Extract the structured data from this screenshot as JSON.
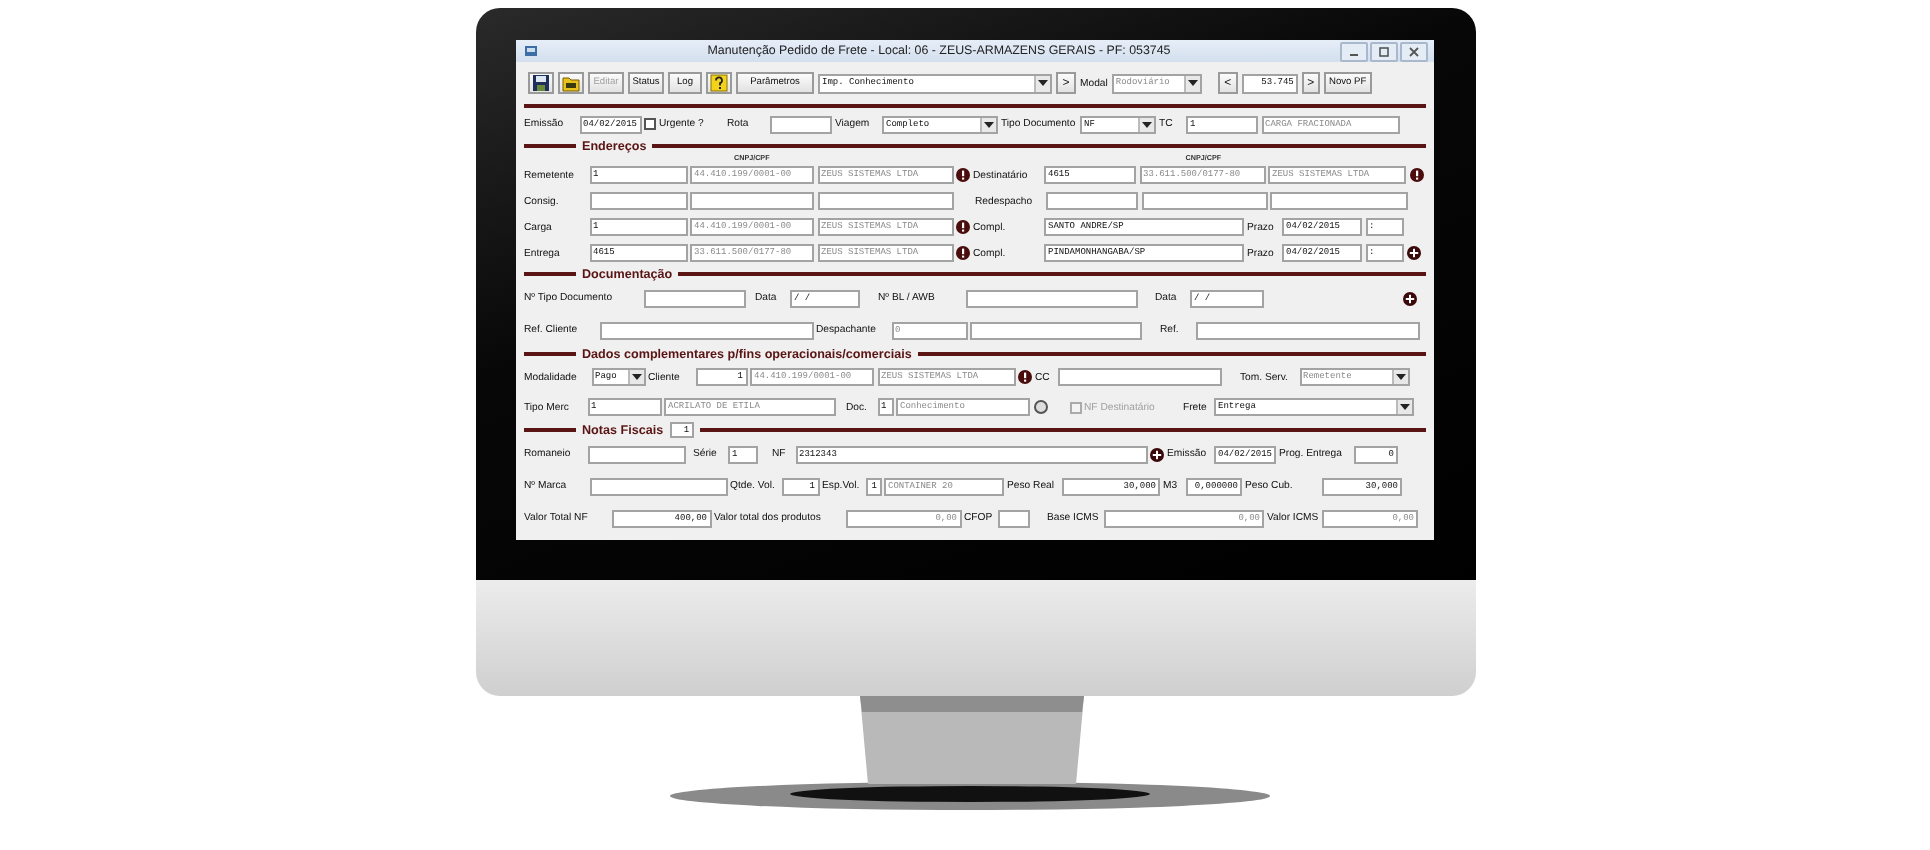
{
  "window": {
    "title": "Manutenção Pedido de Frete - Local: 06 - ZEUS-ARMAZENS GERAIS - PF: 053745"
  },
  "toolbar": {
    "buttons": [
      {
        "label": "Editar",
        "disabled": true
      },
      {
        "label": "Status",
        "disabled": false
      },
      {
        "label": "Log",
        "disabled": false
      }
    ],
    "parameters_button": "Parâmetros",
    "print_select": "Imp. Conhecimento",
    "print_next": ">",
    "modal_label": "Modal",
    "modal_select": {
      "value": "Rodoviário",
      "disabled": true
    },
    "prev": "<",
    "record_number": "53.745",
    "next": ">",
    "new_button": "Novo PF"
  },
  "top_row": [
    {
      "kind": "label",
      "text": "Emissão"
    },
    {
      "kind": "field",
      "value": "04/02/2015",
      "disabled": false
    },
    {
      "kind": "checkbox",
      "label": "Urgente ?",
      "checked": false,
      "disabled": false
    },
    {
      "kind": "label",
      "text": "Rota"
    },
    {
      "kind": "field"
    },
    {
      "kind": "label",
      "text": "Viagem"
    },
    {
      "kind": "select",
      "value": "Completo",
      "disabled": false
    },
    {
      "kind": "label",
      "text": "Tipo Documento"
    },
    {
      "kind": "select",
      "value": "NF",
      "disabled": false
    },
    {
      "kind": "label",
      "text": "TC"
    },
    {
      "kind": "field",
      "value": "1",
      "disabled": false
    },
    {
      "kind": "field",
      "value": "CARGA FRACIONADA",
      "disabled": true
    }
  ],
  "sections": [
    {
      "title": "Endereços",
      "column_headers": [
        "CNPJ/CPF",
        "CNPJ/CPF"
      ],
      "rows": [
        {
          "items": [
            {
              "kind": "label",
              "text": "Remetente"
            },
            {
              "kind": "field",
              "value": "1",
              "disabled": false
            },
            {
              "kind": "field",
              "value": "44.410.199/0001-00",
              "disabled": true
            },
            {
              "kind": "field",
              "value": "ZEUS SISTEMAS LTDA",
              "disabled": true
            },
            {
              "kind": "info"
            },
            {
              "kind": "label",
              "text": "Destinatário"
            },
            {
              "kind": "field",
              "value": "4615",
              "disabled": false
            },
            {
              "kind": "field",
              "value": "33.611.500/0177-80",
              "disabled": true
            },
            {
              "kind": "field",
              "value": "ZEUS SISTEMAS LTDA",
              "disabled": true
            },
            {
              "kind": "info"
            }
          ]
        },
        {
          "items": [
            {
              "kind": "label",
              "text": "Consig."
            },
            {
              "kind": "field"
            },
            {
              "kind": "field"
            },
            {
              "kind": "field"
            },
            {
              "kind": "label",
              "text": "Redespacho"
            },
            {
              "kind": "field"
            },
            {
              "kind": "field"
            },
            {
              "kind": "field"
            }
          ]
        },
        {
          "items": [
            {
              "kind": "label",
              "text": "Carga"
            },
            {
              "kind": "field",
              "value": "1",
              "disabled": false
            },
            {
              "kind": "field",
              "value": "44.410.199/0001-00",
              "disabled": true
            },
            {
              "kind": "field",
              "value": "ZEUS SISTEMAS LTDA",
              "disabled": true
            },
            {
              "kind": "info"
            },
            {
              "kind": "label",
              "text": "Compl."
            },
            {
              "kind": "field",
              "value": "SANTO ANDRE/SP",
              "disabled": false
            },
            {
              "kind": "label",
              "text": "Prazo"
            },
            {
              "kind": "field",
              "value": "04/02/2015",
              "disabled": false
            },
            {
              "kind": "field",
              "value": ":",
              "disabled": false
            }
          ]
        },
        {
          "items": [
            {
              "kind": "label",
              "text": "Entrega"
            },
            {
              "kind": "field",
              "value": "4615",
              "disabled": false
            },
            {
              "kind": "field",
              "value": "33.611.500/0177-80",
              "disabled": true
            },
            {
              "kind": "field",
              "value": "ZEUS SISTEMAS LTDA",
              "disabled": true
            },
            {
              "kind": "info"
            },
            {
              "kind": "label",
              "text": "Compl."
            },
            {
              "kind": "field",
              "value": "PINDAMONHANGABA/SP",
              "disabled": false
            },
            {
              "kind": "label",
              "text": "Prazo"
            },
            {
              "kind": "field",
              "value": "04/02/2015",
              "disabled": false
            },
            {
              "kind": "field",
              "value": ":",
              "disabled": false
            },
            {
              "kind": "add"
            }
          ]
        }
      ]
    },
    {
      "title": "Documentação",
      "rows": [
        {
          "items": [
            {
              "kind": "label",
              "text": "Nº Tipo Documento"
            },
            {
              "kind": "field"
            },
            {
              "kind": "label",
              "text": "Data"
            },
            {
              "kind": "field",
              "value": "/ /",
              "disabled": false
            },
            {
              "kind": "label",
              "text": "Nº BL / AWB"
            },
            {
              "kind": "field"
            },
            {
              "kind": "label",
              "text": "Data"
            },
            {
              "kind": "field",
              "value": "/ /",
              "disabled": false
            },
            {
              "kind": "add"
            }
          ]
        },
        {
          "items": [
            {
              "kind": "label",
              "text": "Ref. Cliente"
            },
            {
              "kind": "field"
            },
            {
              "kind": "label",
              "text": "Despachante"
            },
            {
              "kind": "field",
              "value": "0",
              "disabled": true
            },
            {
              "kind": "field"
            },
            {
              "kind": "label",
              "text": "Ref."
            },
            {
              "kind": "field"
            }
          ]
        }
      ]
    },
    {
      "title": "Dados complementares p/fins operacionais/comerciais",
      "rows": [
        {
          "items": [
            {
              "kind": "label",
              "text": "Modalidade"
            },
            {
              "kind": "select",
              "value": "Pago",
              "disabled": false
            },
            {
              "kind": "label",
              "text": "Cliente"
            },
            {
              "kind": "number",
              "value": "1",
              "disabled": false
            },
            {
              "kind": "field",
              "value": "44.410.199/0001-00",
              "disabled": true
            },
            {
              "kind": "field",
              "value": "ZEUS SISTEMAS LTDA",
              "disabled": true
            },
            {
              "kind": "info"
            },
            {
              "kind": "label",
              "text": "CC"
            },
            {
              "kind": "field"
            },
            {
              "kind": "label",
              "text": "Tom. Serv."
            },
            {
              "kind": "select",
              "value": "Remetente",
              "disabled": true
            }
          ]
        },
        {
          "items": [
            {
              "kind": "label",
              "text": "Tipo Merc"
            },
            {
              "kind": "field",
              "value": "1",
              "disabled": false
            },
            {
              "kind": "field",
              "value": "ACRILATO DE ETILA",
              "disabled": true
            },
            {
              "kind": "label",
              "text": "Doc."
            },
            {
              "kind": "field",
              "value": "1",
              "disabled": false
            },
            {
              "kind": "field",
              "value": "Conhecimento",
              "disabled": true
            },
            {
              "kind": "circle"
            },
            {
              "kind": "checkbox",
              "label": "NF Destinatário",
              "checked": false,
              "disabled": true
            },
            {
              "kind": "label",
              "text": "Frete"
            },
            {
              "kind": "select",
              "value": "Entrega",
              "disabled": false
            }
          ]
        }
      ]
    },
    {
      "title": "Notas Fiscais",
      "count": "1",
      "rows": [
        {
          "items": [
            {
              "kind": "label",
              "text": "Romaneio"
            },
            {
              "kind": "field"
            },
            {
              "kind": "label",
              "text": "Série"
            },
            {
              "kind": "field",
              "value": "1",
              "disabled": false
            },
            {
              "kind": "label",
              "text": "NF"
            },
            {
              "kind": "field",
              "value": "2312343",
              "disabled": false
            },
            {
              "kind": "add"
            },
            {
              "kind": "label",
              "text": "Emissão"
            },
            {
              "kind": "field",
              "value": "04/02/2015",
              "disabled": false
            },
            {
              "kind": "label",
              "text": "Prog. Entrega"
            },
            {
              "kind": "number",
              "value": "0",
              "disabled": false
            }
          ]
        },
        {
          "items": [
            {
              "kind": "label",
              "text": "Nº Marca"
            },
            {
              "kind": "field"
            },
            {
              "kind": "label",
              "text": "Qtde. Vol."
            },
            {
              "kind": "number",
              "value": "1",
              "disabled": false
            },
            {
              "kind": "label",
              "text": "Esp.Vol."
            },
            {
              "kind": "number",
              "value": "1",
              "disabled": false
            },
            {
              "kind": "field",
              "value": "CONTAINER 20",
              "disabled": true
            },
            {
              "kind": "label",
              "text": "Peso Real"
            },
            {
              "kind": "number",
              "value": "30,000",
              "disabled": false
            },
            {
              "kind": "label",
              "text": "M3"
            },
            {
              "kind": "number",
              "value": "0,000000",
              "disabled": false
            },
            {
              "kind": "label",
              "text": "Peso Cub."
            },
            {
              "kind": "number",
              "value": "30,000",
              "disabled": false
            }
          ]
        },
        {
          "items": [
            {
              "kind": "label",
              "text": "Valor Total NF"
            },
            {
              "kind": "number",
              "value": "400,00",
              "disabled": false
            },
            {
              "kind": "label",
              "text": "Valor total dos produtos"
            },
            {
              "kind": "number",
              "value": "0,00",
              "disabled": true
            },
            {
              "kind": "label",
              "text": "CFOP"
            },
            {
              "kind": "field"
            },
            {
              "kind": "label",
              "text": "Base ICMS"
            },
            {
              "kind": "number",
              "value": "0,00",
              "disabled": true
            },
            {
              "kind": "label",
              "text": "Valor ICMS"
            },
            {
              "kind": "number",
              "value": "0,00",
              "disabled": true
            }
          ]
        }
      ]
    }
  ]
}
